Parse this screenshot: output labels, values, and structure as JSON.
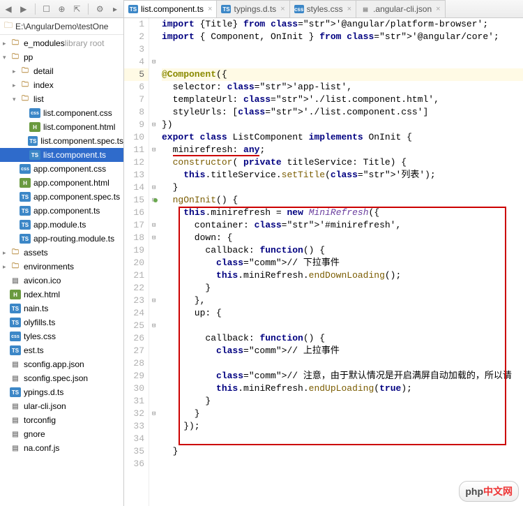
{
  "toolbar_icons": [
    "left-icon",
    "right-icon",
    "folder-icon",
    "target-icon",
    "collapse-icon",
    "gear-icon",
    "hide-icon"
  ],
  "path": "E:\\AngularDemo\\testOne",
  "tree": [
    {
      "i": 0,
      "exp": ">",
      "ic": "folder",
      "label": "e_modules",
      "suffix": "library root",
      "cls": ""
    },
    {
      "i": 0,
      "exp": "v",
      "ic": "folder",
      "label": "pp",
      "suffix": "",
      "cls": ""
    },
    {
      "i": 1,
      "exp": ">",
      "ic": "folder",
      "label": "detail",
      "suffix": "",
      "cls": ""
    },
    {
      "i": 1,
      "exp": ">",
      "ic": "folder",
      "label": "index",
      "suffix": "",
      "cls": ""
    },
    {
      "i": 1,
      "exp": "v",
      "ic": "folder",
      "label": "list",
      "suffix": "",
      "cls": ""
    },
    {
      "i": 2,
      "exp": "",
      "ic": "css",
      "label": "list.component.css",
      "suffix": "",
      "cls": ""
    },
    {
      "i": 2,
      "exp": "",
      "ic": "html",
      "label": "list.component.html",
      "suffix": "",
      "cls": ""
    },
    {
      "i": 2,
      "exp": "",
      "ic": "ts",
      "label": "list.component.spec.ts",
      "suffix": "",
      "cls": ""
    },
    {
      "i": 2,
      "exp": "",
      "ic": "ts",
      "label": "list.component.ts",
      "suffix": "",
      "cls": "selected"
    },
    {
      "i": 1,
      "exp": "",
      "ic": "css",
      "label": "app.component.css",
      "suffix": "",
      "cls": ""
    },
    {
      "i": 1,
      "exp": "",
      "ic": "html",
      "label": "app.component.html",
      "suffix": "",
      "cls": ""
    },
    {
      "i": 1,
      "exp": "",
      "ic": "ts",
      "label": "app.component.spec.ts",
      "suffix": "",
      "cls": ""
    },
    {
      "i": 1,
      "exp": "",
      "ic": "ts",
      "label": "app.component.ts",
      "suffix": "",
      "cls": ""
    },
    {
      "i": 1,
      "exp": "",
      "ic": "ts",
      "label": "app.module.ts",
      "suffix": "",
      "cls": ""
    },
    {
      "i": 1,
      "exp": "",
      "ic": "ts",
      "label": "app-routing.module.ts",
      "suffix": "",
      "cls": ""
    },
    {
      "i": 0,
      "exp": ">",
      "ic": "folder",
      "label": "assets",
      "suffix": "",
      "cls": ""
    },
    {
      "i": 0,
      "exp": ">",
      "ic": "folder",
      "label": "environments",
      "suffix": "",
      "cls": ""
    },
    {
      "i": 0,
      "exp": "",
      "ic": "file",
      "label": "avicon.ico",
      "suffix": "",
      "cls": ""
    },
    {
      "i": 0,
      "exp": "",
      "ic": "html",
      "label": "ndex.html",
      "suffix": "",
      "cls": ""
    },
    {
      "i": 0,
      "exp": "",
      "ic": "ts",
      "label": "nain.ts",
      "suffix": "",
      "cls": ""
    },
    {
      "i": 0,
      "exp": "",
      "ic": "ts",
      "label": "olyfills.ts",
      "suffix": "",
      "cls": ""
    },
    {
      "i": 0,
      "exp": "",
      "ic": "css",
      "label": "tyles.css",
      "suffix": "",
      "cls": ""
    },
    {
      "i": 0,
      "exp": "",
      "ic": "ts",
      "label": "est.ts",
      "suffix": "",
      "cls": ""
    },
    {
      "i": 0,
      "exp": "",
      "ic": "file",
      "label": "sconfig.app.json",
      "suffix": "",
      "cls": ""
    },
    {
      "i": 0,
      "exp": "",
      "ic": "file",
      "label": "sconfig.spec.json",
      "suffix": "",
      "cls": ""
    },
    {
      "i": 0,
      "exp": "",
      "ic": "ts",
      "label": "ypings.d.ts",
      "suffix": "",
      "cls": ""
    },
    {
      "i": 0,
      "exp": "",
      "ic": "file",
      "label": "ular-cli.json",
      "suffix": "",
      "cls": ""
    },
    {
      "i": 0,
      "exp": "",
      "ic": "file",
      "label": "torconfig",
      "suffix": "",
      "cls": ""
    },
    {
      "i": 0,
      "exp": "",
      "ic": "file",
      "label": "gnore",
      "suffix": "",
      "cls": ""
    },
    {
      "i": 0,
      "exp": "",
      "ic": "file",
      "label": "na.conf.js",
      "suffix": "",
      "cls": ""
    }
  ],
  "tabs": [
    {
      "label": "list.component.ts",
      "ic": "ts",
      "active": true
    },
    {
      "label": "typings.d.ts",
      "ic": "ts",
      "active": false
    },
    {
      "label": "styles.css",
      "ic": "css",
      "active": false
    },
    {
      "label": ".angular-cli.json",
      "ic": "file",
      "active": false
    }
  ],
  "code": {
    "start_line": 1,
    "current": 5,
    "lines": [
      "import {Title} from '@angular/platform-browser';",
      "import { Component, OnInit } from '@angular/core';",
      "",
      "",
      "@Component({",
      "  selector: 'app-list',",
      "  templateUrl: './list.component.html',",
      "  styleUrls: ['./list.component.css']",
      "})",
      "export class ListComponent implements OnInit {",
      "  minirefresh: any;",
      "  constructor( private titleService: Title) {",
      "    this.titleService.setTitle('列表');",
      "  }",
      "  ngOnInit() {",
      "    this.minirefresh = new MiniRefresh({",
      "      container: '#minirefresh',",
      "      down: {",
      "        callback: function() {",
      "          // 下拉事件",
      "          this.miniRefresh.endDownLoading();",
      "        }",
      "      },",
      "      up: {",
      "",
      "        callback: function() {",
      "          // 上拉事件",
      "",
      "          // 注意，由于默认情况是开启满屏自动加载的，所以请",
      "          this.miniRefresh.endUpLoading(true);",
      "        }",
      "      }",
      "    });",
      "",
      "  }",
      ""
    ]
  },
  "watermark": {
    "a": "php",
    "b": "中文网"
  }
}
